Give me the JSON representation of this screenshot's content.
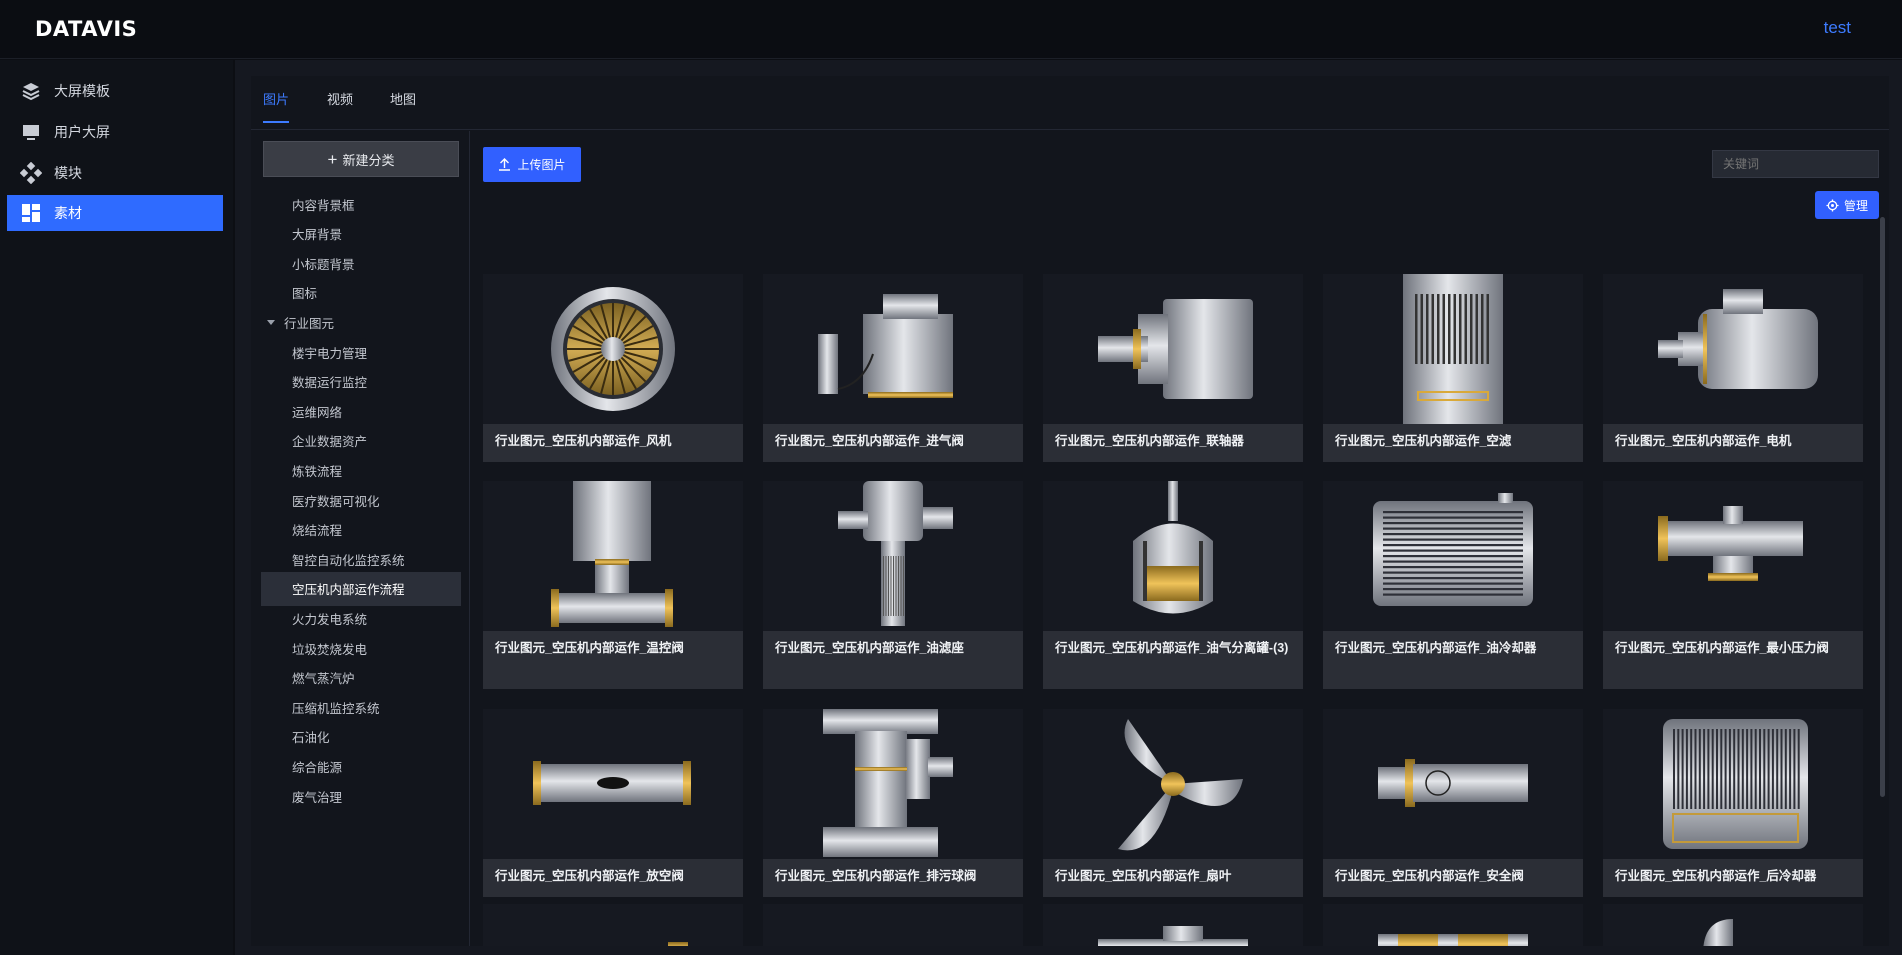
{
  "header": {
    "logo": "DATAVIS",
    "user": "test"
  },
  "sidebar": {
    "items": [
      {
        "label": "大屏模板",
        "icon": "layers-icon"
      },
      {
        "label": "用户大屏",
        "icon": "monitor-icon"
      },
      {
        "label": "模块",
        "icon": "module-icon"
      },
      {
        "label": "素材",
        "icon": "grid-icon",
        "active": true
      }
    ]
  },
  "tabs": [
    {
      "label": "图片",
      "active": true
    },
    {
      "label": "视频"
    },
    {
      "label": "地图"
    }
  ],
  "categories": {
    "new_button": "新建分类",
    "items": [
      {
        "label": "内容背景框"
      },
      {
        "label": "大屏背景"
      },
      {
        "label": "小标题背景"
      },
      {
        "label": "图标"
      },
      {
        "label": "行业图元",
        "group": true
      },
      {
        "label": "楼宇电力管理"
      },
      {
        "label": "数据运行监控"
      },
      {
        "label": "运维网络"
      },
      {
        "label": "企业数据资产"
      },
      {
        "label": "炼铁流程"
      },
      {
        "label": "医疗数据可视化"
      },
      {
        "label": "烧结流程"
      },
      {
        "label": "智控自动化监控系统"
      },
      {
        "label": "空压机内部运作流程",
        "active": true
      },
      {
        "label": "火力发电系统"
      },
      {
        "label": "垃圾焚烧发电"
      },
      {
        "label": "燃气蒸汽炉"
      },
      {
        "label": "压缩机监控系统"
      },
      {
        "label": "石油化"
      },
      {
        "label": "综合能源"
      },
      {
        "label": "废气治理"
      }
    ]
  },
  "toolbar": {
    "upload_label": "上传图片",
    "search_placeholder": "关键词",
    "manage_label": "管理"
  },
  "colors": {
    "accent": "#3160ff",
    "active_text": "#3d7bff"
  },
  "cards": [
    {
      "caption": "行业图元_空压机内部运作_风机",
      "icon": "fan-machine-icon"
    },
    {
      "caption": "行业图元_空压机内部运作_进气阀",
      "icon": "intake-valve-icon"
    },
    {
      "caption": "行业图元_空压机内部运作_联轴器",
      "icon": "coupling-icon"
    },
    {
      "caption": "行业图元_空压机内部运作_空滤",
      "icon": "air-filter-icon"
    },
    {
      "caption": "行业图元_空压机内部运作_电机",
      "icon": "motor-icon"
    },
    {
      "caption": "行业图元_空压机内部运作_温控阀",
      "icon": "thermostatic-valve-icon"
    },
    {
      "caption": "行业图元_空压机内部运作_油滤座",
      "icon": "oil-filter-icon"
    },
    {
      "caption": "行业图元_空压机内部运作_油气分离罐-(3)",
      "icon": "separator-tank-icon"
    },
    {
      "caption": "行业图元_空压机内部运作_油冷却器",
      "icon": "oil-cooler-icon"
    },
    {
      "caption": "行业图元_空压机内部运作_最小压力阀",
      "icon": "min-pressure-valve-icon"
    },
    {
      "caption": "行业图元_空压机内部运作_放空阀",
      "icon": "vent-valve-icon"
    },
    {
      "caption": "行业图元_空压机内部运作_排污球阀",
      "icon": "drain-valve-icon"
    },
    {
      "caption": "行业图元_空压机内部运作_扇叶",
      "icon": "propeller-icon"
    },
    {
      "caption": "行业图元_空压机内部运作_安全阀",
      "icon": "safety-valve-icon"
    },
    {
      "caption": "行业图元_空压机内部运作_后冷却器",
      "icon": "after-cooler-icon"
    }
  ]
}
